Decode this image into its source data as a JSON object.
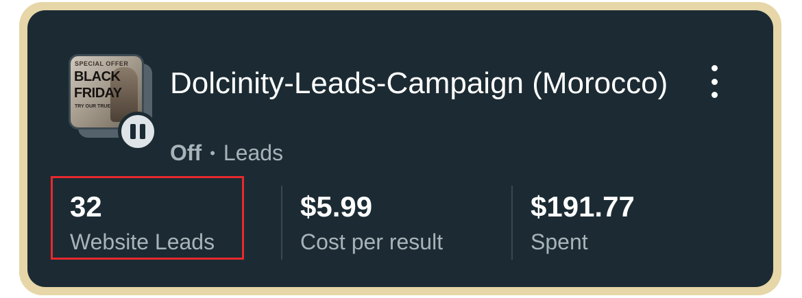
{
  "campaign": {
    "title": "Dolcinity-Leads-Campaign (Morocco)",
    "status": "Off",
    "separator": "•",
    "objective": "Leads",
    "thumbnail": {
      "line1": "SPECIAL OFFER",
      "line2": "BLACK",
      "line3": "FRIDAY",
      "line4": "TRY OUR TRUE"
    },
    "status_icon": "pause-icon",
    "menu_icon": "more-vertical-icon"
  },
  "metrics": [
    {
      "value": "32",
      "label": "Website Leads"
    },
    {
      "value": "$5.99",
      "label": "Cost per result"
    },
    {
      "value": "$191.77",
      "label": "Spent"
    }
  ],
  "colors": {
    "card_bg": "#1c2b33",
    "frame": "#e6d6a8",
    "highlight_border": "#e8292d",
    "muted_text": "#a8b3ba"
  }
}
